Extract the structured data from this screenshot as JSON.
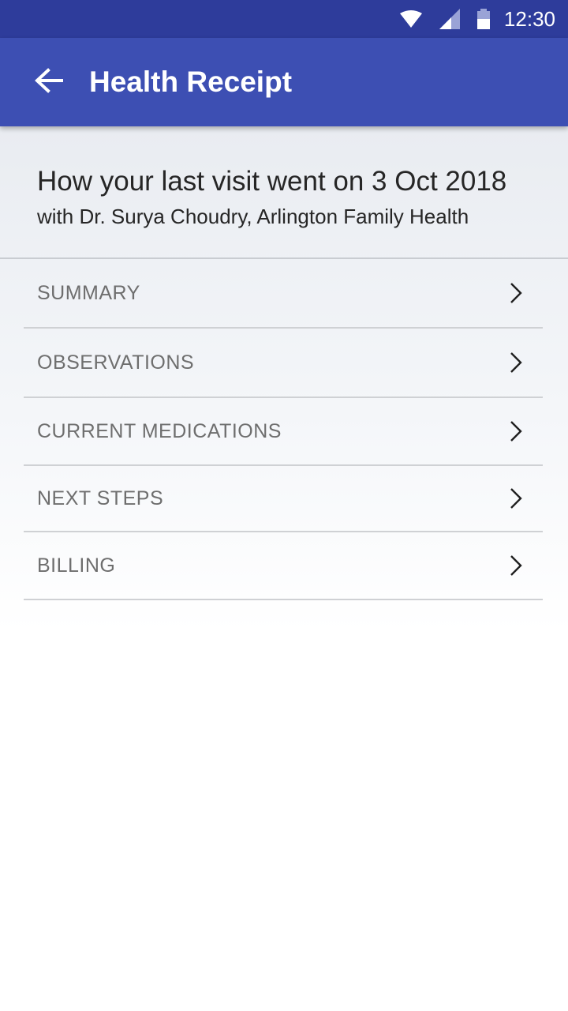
{
  "status_bar": {
    "time": "12:30",
    "icons": [
      "wifi-icon",
      "cell-signal-icon",
      "battery-icon"
    ],
    "background": "#2e3c9b"
  },
  "app_bar": {
    "title": "Health Receipt",
    "back_icon": "arrow-back-icon",
    "background": "#3d4fb3"
  },
  "visit": {
    "title": "How your last visit went on 3 Oct 2018",
    "subtitle": "with Dr. Surya Choudry, Arlington Family Health"
  },
  "menu": {
    "items": [
      {
        "label": "SUMMARY",
        "icon": "chevron-right-icon"
      },
      {
        "label": "OBSERVATIONS",
        "icon": "chevron-right-icon"
      },
      {
        "label": "CURRENT MEDICATIONS",
        "icon": "chevron-right-icon"
      },
      {
        "label": "NEXT STEPS",
        "icon": "chevron-right-icon"
      },
      {
        "label": "BILLING",
        "icon": "chevron-right-icon"
      }
    ]
  }
}
